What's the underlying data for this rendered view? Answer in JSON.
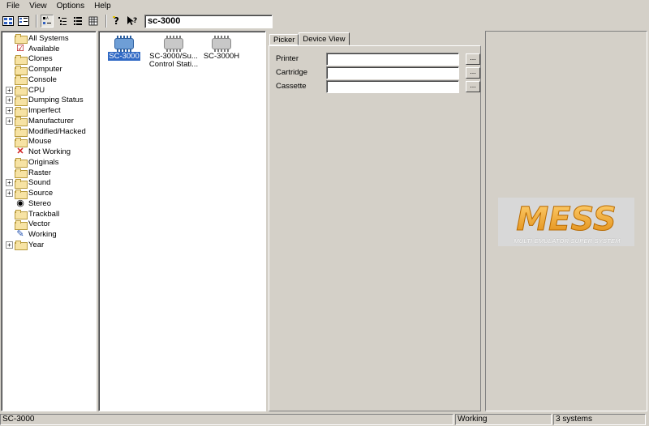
{
  "menu": [
    "File",
    "View",
    "Options",
    "Help"
  ],
  "toolbar": {
    "buttons": [
      "view-large-icons-icon",
      "view-small-icons-icon",
      "view-list-icon",
      "view-details-icon",
      "view-grouped-icon",
      "view-grid-icon",
      "about-icon",
      "context-help-icon"
    ],
    "search_value": "sc-3000"
  },
  "tree": [
    {
      "label": "All Systems",
      "expander": false,
      "icon": "folder"
    },
    {
      "label": "Available",
      "expander": false,
      "icon": "check"
    },
    {
      "label": "Clones",
      "expander": false,
      "icon": "folder"
    },
    {
      "label": "Computer",
      "expander": false,
      "icon": "folder"
    },
    {
      "label": "Console",
      "expander": false,
      "icon": "folder"
    },
    {
      "label": "CPU",
      "expander": true,
      "icon": "folder"
    },
    {
      "label": "Dumping Status",
      "expander": true,
      "icon": "folder"
    },
    {
      "label": "Imperfect",
      "expander": true,
      "icon": "folder"
    },
    {
      "label": "Manufacturer",
      "expander": true,
      "icon": "folder"
    },
    {
      "label": "Modified/Hacked",
      "expander": false,
      "icon": "folder"
    },
    {
      "label": "Mouse",
      "expander": false,
      "icon": "folder"
    },
    {
      "label": "Not Working",
      "expander": false,
      "icon": "x"
    },
    {
      "label": "Originals",
      "expander": false,
      "icon": "folder"
    },
    {
      "label": "Raster",
      "expander": false,
      "icon": "folder"
    },
    {
      "label": "Sound",
      "expander": true,
      "icon": "folder"
    },
    {
      "label": "Source",
      "expander": true,
      "icon": "folder"
    },
    {
      "label": "Stereo",
      "expander": false,
      "icon": "speaker"
    },
    {
      "label": "Trackball",
      "expander": false,
      "icon": "folder"
    },
    {
      "label": "Vector",
      "expander": false,
      "icon": "folder"
    },
    {
      "label": "Working",
      "expander": false,
      "icon": "working"
    },
    {
      "label": "Year",
      "expander": true,
      "icon": "folder"
    }
  ],
  "systems": [
    {
      "line1": "SC-3000",
      "line2": "",
      "selected": true
    },
    {
      "line1": "SC-3000/Su...",
      "line2": "Control Stati...",
      "selected": false
    },
    {
      "line1": "SC-3000H",
      "line2": "",
      "selected": false
    }
  ],
  "tabs": [
    "Picker",
    "Device View"
  ],
  "devices": [
    {
      "label": "Printer",
      "value": "",
      "browse": "..."
    },
    {
      "label": "Cartridge",
      "value": "",
      "browse": "..."
    },
    {
      "label": "Cassette",
      "value": "",
      "browse": "..."
    }
  ],
  "logo": {
    "text": "MESS",
    "subtitle": "MULTI EMULATOR SUPER SYSTEM",
    "accent": "#f5a623"
  },
  "status": {
    "selected": "SC-3000",
    "state": "Working",
    "count": "3 systems"
  }
}
